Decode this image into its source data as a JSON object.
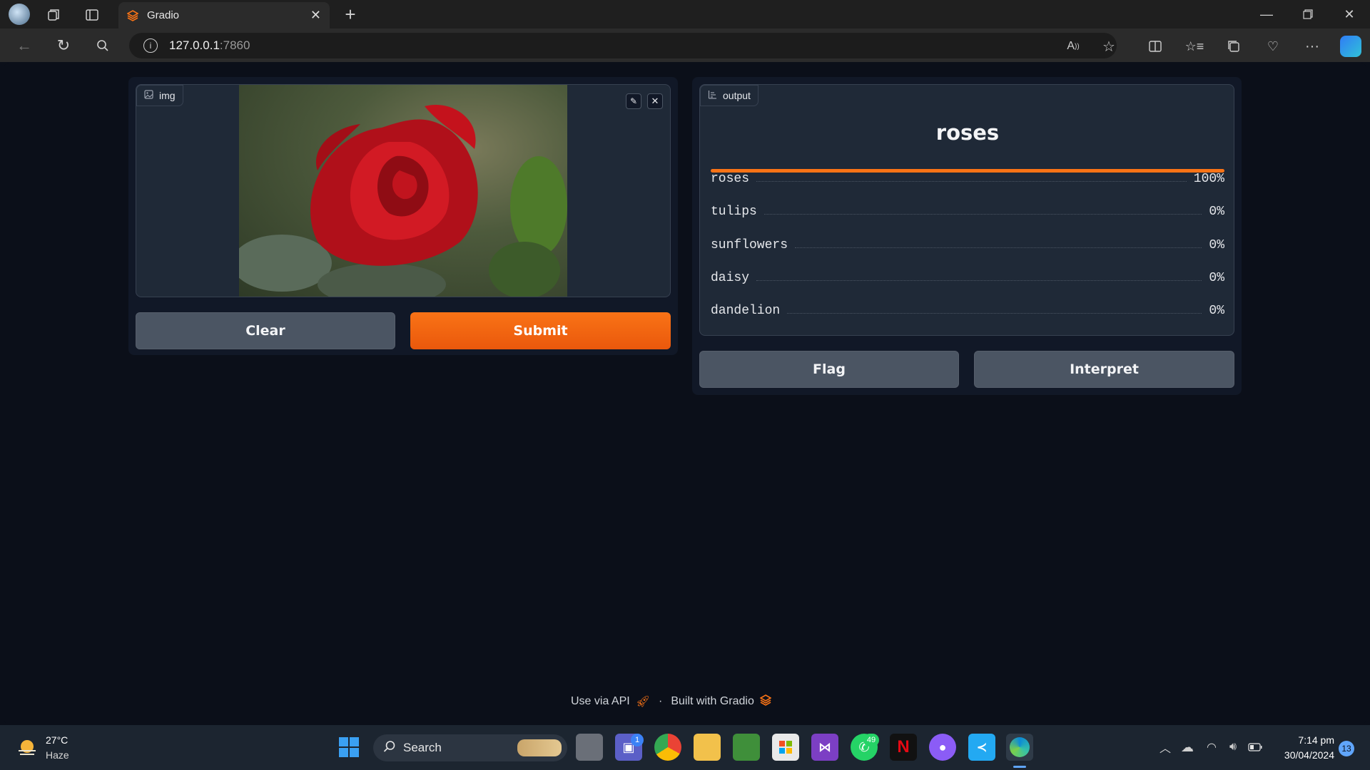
{
  "browser": {
    "tab_title": "Gradio",
    "url_host": "127.0.0.1",
    "url_port": ":7860"
  },
  "input_panel": {
    "label": "img",
    "clear_label": "Clear",
    "submit_label": "Submit"
  },
  "output_panel": {
    "label": "output",
    "top_class": "roses",
    "confidences": [
      {
        "label": "roses",
        "value": "100%"
      },
      {
        "label": "tulips",
        "value": "0%"
      },
      {
        "label": "sunflowers",
        "value": "0%"
      },
      {
        "label": "daisy",
        "value": "0%"
      },
      {
        "label": "dandelion",
        "value": "0%"
      }
    ],
    "top_confidence": 1.0,
    "flag_label": "Flag",
    "interpret_label": "Interpret"
  },
  "footer": {
    "api_link": "Use via API",
    "separator": "·",
    "built_with": "Built with Gradio"
  },
  "taskbar": {
    "weather_temp": "27°C",
    "weather_desc": "Haze",
    "search_placeholder": "Search",
    "teams_badge": "1",
    "whatsapp_badge": "49",
    "time": "7:14 pm",
    "date": "30/04/2024",
    "notification_count": "13"
  },
  "colors": {
    "accent": "#f97316",
    "background": "#0b0f19",
    "panel": "#1f2937"
  }
}
